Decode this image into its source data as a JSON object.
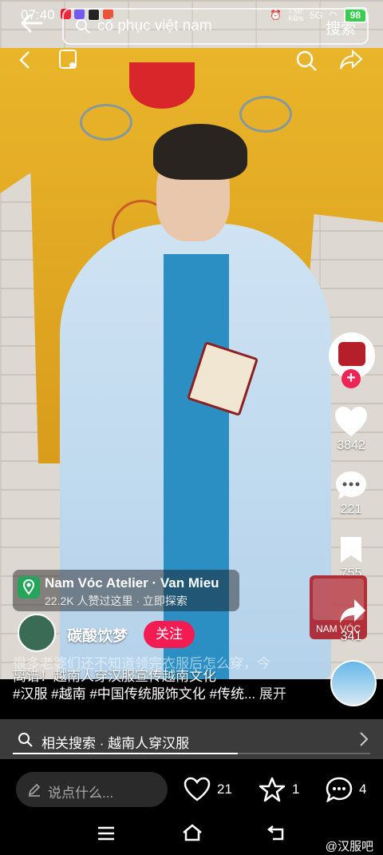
{
  "status_bar": {
    "time": "07:40",
    "net_speed": "7.50\nKB/s",
    "signal_label": "5G",
    "battery": "98"
  },
  "search": {
    "query": "cổ phục việt nam",
    "button_label": "搜索"
  },
  "sidebar": {
    "likes": "3842",
    "comments": "221",
    "favorites": "755",
    "shares": "341"
  },
  "location_card": {
    "title": "Nam Vóc Atelier · Van Mieu",
    "subtitle": "22.2K 人赞过这里 · 立即探索"
  },
  "author": {
    "name": "碳酸饮梦",
    "follow_label": "关注"
  },
  "description": {
    "ghost_line1": "很多老婆们还不知道领完衣服后怎么穿，今",
    "line1": "离谱！越南人穿汉服宣传越南文化",
    "line2": "#汉服 #越南 #中国传统服饰文化 #传统...",
    "more_label": "展开"
  },
  "ad_tile": {
    "label": "NAM VÓC"
  },
  "related_search": {
    "label": "相关搜索 · 越南人穿汉服"
  },
  "progress": {
    "fraction": 0.63
  },
  "bottom": {
    "comment_placeholder": "说点什么...",
    "like_count": "21",
    "star_count": "1",
    "comment_count": "4"
  },
  "watermark": {
    "text": "@汉服吧"
  },
  "colors": {
    "accent": "#f21c53",
    "location_green": "#23a55a"
  }
}
